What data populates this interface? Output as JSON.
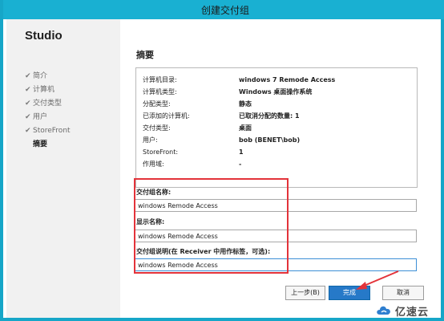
{
  "window": {
    "title": "创建交付组"
  },
  "sidebar": {
    "brand": "Studio",
    "steps": [
      {
        "label": "简介",
        "done": true
      },
      {
        "label": "计算机",
        "done": true
      },
      {
        "label": "交付类型",
        "done": true
      },
      {
        "label": "用户",
        "done": true
      },
      {
        "label": "StoreFront",
        "done": true
      },
      {
        "label": "摘要",
        "done": false,
        "current": true
      }
    ]
  },
  "main": {
    "title": "摘要",
    "summary": [
      {
        "key": "计算机目录:",
        "value": "windows 7 Remode Access"
      },
      {
        "key": "计算机类型:",
        "value": "Windows 桌面操作系统"
      },
      {
        "key": "分配类型:",
        "value": "静态"
      },
      {
        "key": "已添加的计算机:",
        "value": "已取消分配的数量: 1"
      },
      {
        "key": "交付类型:",
        "value": "桌面"
      },
      {
        "key": "用户:",
        "value": "bob (BENET\\bob)"
      },
      {
        "key": "StoreFront:",
        "value": "1"
      },
      {
        "key": "作用域:",
        "value": "-"
      }
    ],
    "fields": {
      "group_name": {
        "label": "交付组名称:",
        "value": "windows Remode Access"
      },
      "display_name": {
        "label": "显示名称:",
        "value": "windows Remode Access"
      },
      "description": {
        "label": "交付组说明(在 Receiver 中用作标签，可选):",
        "value": "windows Remode Access"
      }
    }
  },
  "buttons": {
    "back": "上一步(B)",
    "finish": "完成",
    "cancel": "取消"
  },
  "watermark": {
    "text": "亿速云"
  },
  "colors": {
    "titlebar": "#19b0d2",
    "primary_button": "#2679c8",
    "highlight": "#e3333a"
  }
}
